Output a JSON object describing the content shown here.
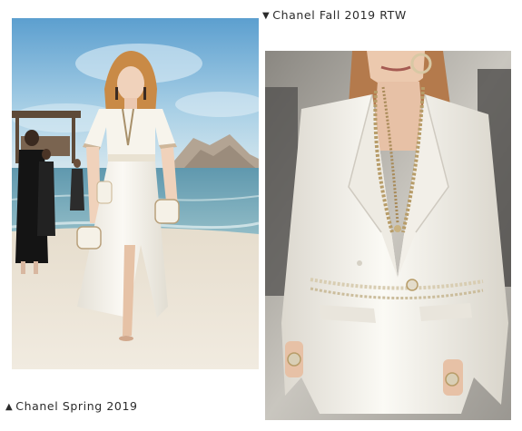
{
  "captions": {
    "top": {
      "marker": "▼",
      "text": "Chanel Fall 2019 RTW"
    },
    "bottom": {
      "marker": "▲",
      "text": "Chanel Spring 2019"
    }
  },
  "photos": {
    "left": {
      "palette": {
        "sky": "#8fc0df",
        "sea": "#6ea2b7",
        "sand": "#ece4d6",
        "garment": "#f6f3ec",
        "hair": "#c98a46"
      }
    },
    "right": {
      "palette": {
        "background": "#bdbab4",
        "garment": "#f3f1ea",
        "chain": "#b79c68",
        "hair": "#b47a4c"
      }
    }
  },
  "colors": {
    "caption_text": "#2b2b2b",
    "page_background": "#ffffff"
  }
}
